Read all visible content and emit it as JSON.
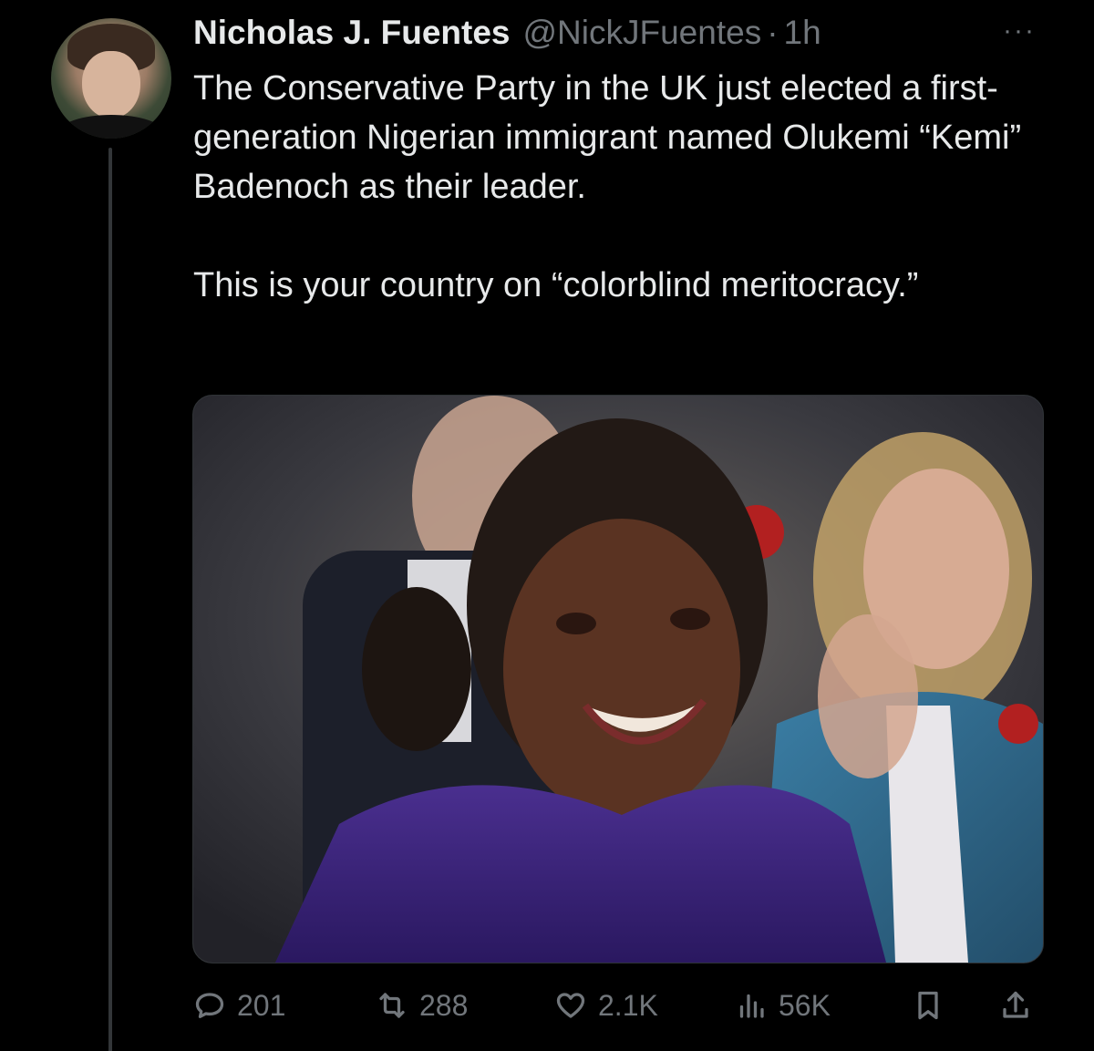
{
  "author": {
    "name": "Nicholas J. Fuentes",
    "handle": "@NickJFuentes",
    "separator": "·",
    "time": "1h"
  },
  "more_label": "···",
  "tweet": {
    "paragraph_1": "The Conservative Party in the UK just elected a first-generation Nigerian immigrant named Olukemi “Kemi” Badenoch as their leader.",
    "paragraph_2": "This is your country on “colorblind meritocracy.”"
  },
  "media": {
    "icon": "photo"
  },
  "actions": {
    "replies": "201",
    "retweets": "288",
    "likes": "2.1K",
    "views": "56K"
  },
  "colors": {
    "background": "#000000",
    "primary_text": "#e7e9ea",
    "secondary_text": "#71767b",
    "thread_line": "#333639"
  }
}
